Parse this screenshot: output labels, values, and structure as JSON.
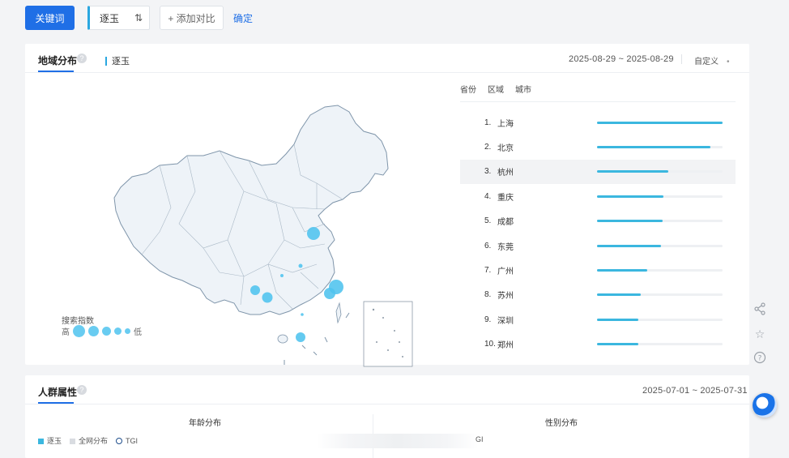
{
  "toolbar": {
    "keyword_button": "关键词",
    "keyword_value": "逐玉",
    "add_compare": "+ 添加对比",
    "confirm": "确定"
  },
  "region_card": {
    "title": "地域分布",
    "keyword_legend": "逐玉",
    "date_range": "2025-08-29 ~ 2025-08-29",
    "custom": "自定义",
    "custom_arrow": "•",
    "tabs": [
      "省份",
      "区域",
      "城市"
    ],
    "map_legend_title": "搜索指数",
    "map_legend_high": "高",
    "map_legend_low": "低",
    "ranking": [
      {
        "num": "1.",
        "city": "上海",
        "value": 1.0
      },
      {
        "num": "2.",
        "city": "北京",
        "value": 0.9
      },
      {
        "num": "3.",
        "city": "杭州",
        "value": 0.57
      },
      {
        "num": "4.",
        "city": "重庆",
        "value": 0.53
      },
      {
        "num": "5.",
        "city": "成都",
        "value": 0.52
      },
      {
        "num": "6.",
        "city": "东莞",
        "value": 0.51
      },
      {
        "num": "7.",
        "city": "广州",
        "value": 0.4
      },
      {
        "num": "8.",
        "city": "苏州",
        "value": 0.35
      },
      {
        "num": "9.",
        "city": "深圳",
        "value": 0.33
      },
      {
        "num": "10.",
        "city": "郑州",
        "value": 0.33
      }
    ],
    "highlight_index": 2,
    "colors": {
      "accent": "#1f6fe6",
      "bar": "#3bb7df",
      "bubble": "#4fc3ee",
      "map_fill": "#eef3f8",
      "map_stroke": "#7f95aa"
    }
  },
  "crowd_card": {
    "title": "人群属性",
    "date_range": "2025-07-01 ~ 2025-07-31",
    "age_title": "年龄分布",
    "gender_title": "性别分布",
    "legend": [
      "逐玉",
      "全网分布",
      "TGI"
    ],
    "right_tgi": "GI"
  },
  "side_icons": [
    "share-icon",
    "star-icon",
    "help-icon"
  ]
}
